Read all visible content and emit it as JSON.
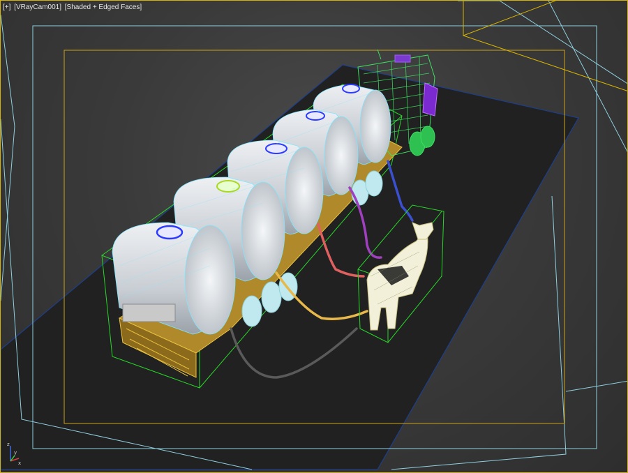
{
  "viewport": {
    "menu_label": "[+]",
    "camera_label": "[VRayCam001]",
    "shading_label": "[Shaded + Edged Faces]",
    "separator": " "
  },
  "gizmo": {
    "x_label": "x",
    "y_label": "y",
    "z_label": "z",
    "x_color": "#e03a3a",
    "y_color": "#3ac43a",
    "z_color": "#3a6ae0"
  },
  "colors": {
    "viewport_border": "#d8b400",
    "safe_frame_outer": "#9ad8e8",
    "safe_frame_inner": "#c9a21a",
    "ground_plane": "#0a1a3a",
    "tank_body": "#d9dde2",
    "tank_wire": "#7fe6ff",
    "trailer": "#e0b030",
    "cab": "#3ce060",
    "selection_box": "#28d828",
    "cow_wire": "#f0f0c0"
  }
}
